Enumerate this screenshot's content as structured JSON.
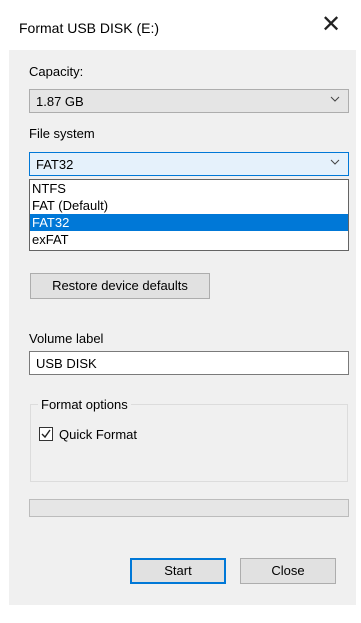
{
  "window": {
    "title": "Format USB DISK (E:)",
    "close_icon": "close-icon"
  },
  "capacity": {
    "label": "Capacity:",
    "value": "1.87 GB"
  },
  "file_system": {
    "label": "File system",
    "value": "FAT32",
    "options": [
      "NTFS",
      "FAT (Default)",
      "FAT32",
      "exFAT"
    ],
    "selected_index": 2
  },
  "restore_button": "Restore device defaults",
  "volume": {
    "label": "Volume label",
    "value": "USB DISK"
  },
  "format_options": {
    "title": "Format options",
    "quick_format_label": "Quick Format",
    "quick_format_checked": true
  },
  "progress": {
    "value": 0
  },
  "buttons": {
    "start": "Start",
    "close": "Close"
  },
  "colors": {
    "accent": "#0078d7",
    "dialog_bg": "#f0f0f0"
  }
}
